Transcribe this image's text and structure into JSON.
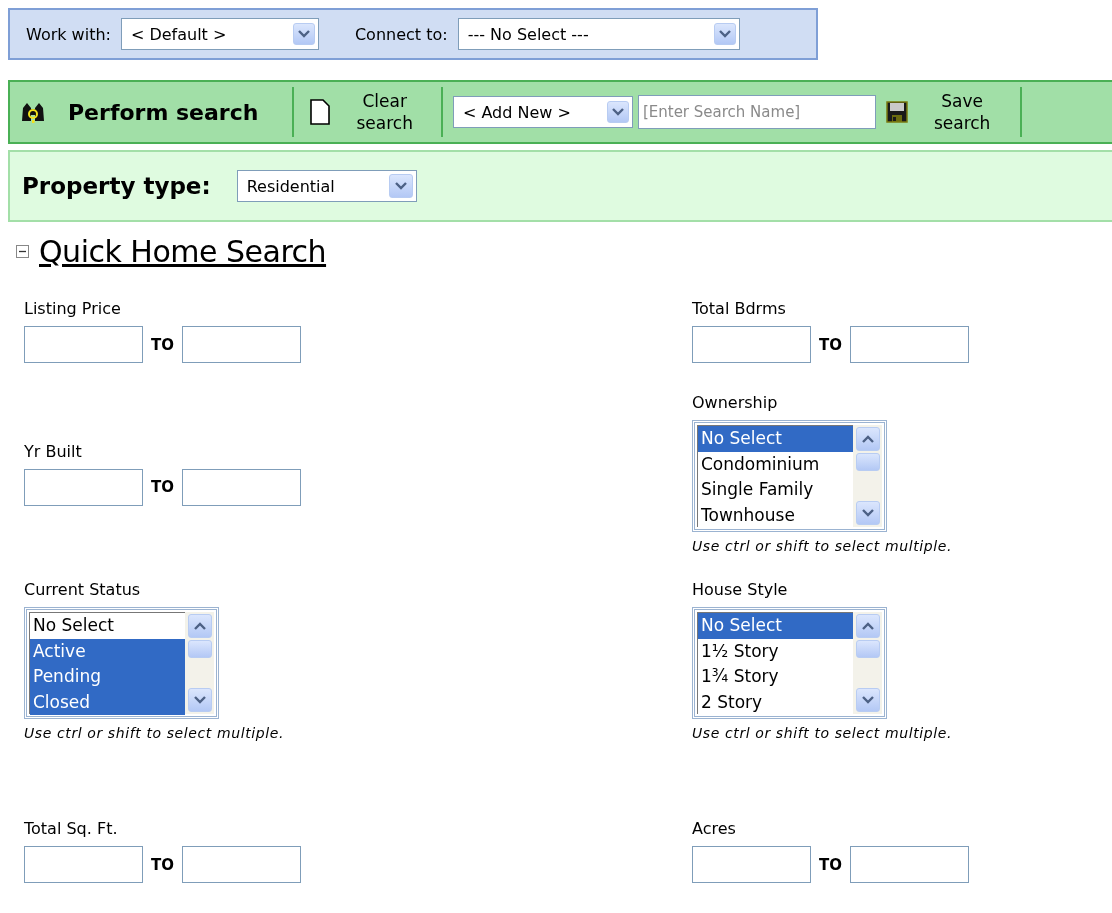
{
  "context_bar": {
    "work_with": {
      "label": "Work with:",
      "value": "< Default >"
    },
    "connect_to": {
      "label": "Connect to:",
      "value": "--- No Select ---"
    }
  },
  "toolbar": {
    "perform": "Perform search",
    "clear": "Clear search",
    "saved_search": "< Add New >",
    "search_name": {
      "placeholder": "[Enter Search Name]"
    },
    "save": "Save search"
  },
  "property_type": {
    "label": "Property type:",
    "value": "Residential"
  },
  "section": {
    "title": "Quick Home Search",
    "expanded": true
  },
  "form_rows": [
    [
      {
        "kind": "range",
        "label": "Listing Price",
        "separator": "TO"
      },
      {
        "kind": "range",
        "label": "Total Bdrms",
        "separator": "TO"
      }
    ],
    [
      {
        "kind": "range",
        "label": "Yr Built",
        "separator": "TO"
      },
      {
        "kind": "listbox",
        "label": "Ownership",
        "options": [
          {
            "label": "No Select",
            "selected": true
          },
          {
            "label": "Condominium",
            "selected": false
          },
          {
            "label": "Single Family",
            "selected": false
          },
          {
            "label": "Townhouse",
            "selected": false
          }
        ],
        "hint": "Use ctrl or shift to select multiple."
      }
    ],
    [
      {
        "kind": "listbox",
        "label": "Current Status",
        "options": [
          {
            "label": "No Select",
            "selected": false
          },
          {
            "label": "Active",
            "selected": true
          },
          {
            "label": "Pending",
            "selected": true
          },
          {
            "label": "Closed",
            "selected": true
          }
        ],
        "hint": "Use ctrl or shift to select multiple."
      },
      {
        "kind": "listbox",
        "label": "House Style",
        "options": [
          {
            "label": "No Select",
            "selected": true
          },
          {
            "label": "1½ Story",
            "selected": false
          },
          {
            "label": "1¾ Story",
            "selected": false
          },
          {
            "label": "2 Story",
            "selected": false
          }
        ],
        "hint": "Use ctrl or shift to select multiple."
      }
    ],
    [
      {
        "kind": "range",
        "label": "Total Sq. Ft.",
        "separator": "TO"
      },
      {
        "kind": "range",
        "label": "Acres",
        "separator": "TO"
      }
    ]
  ]
}
